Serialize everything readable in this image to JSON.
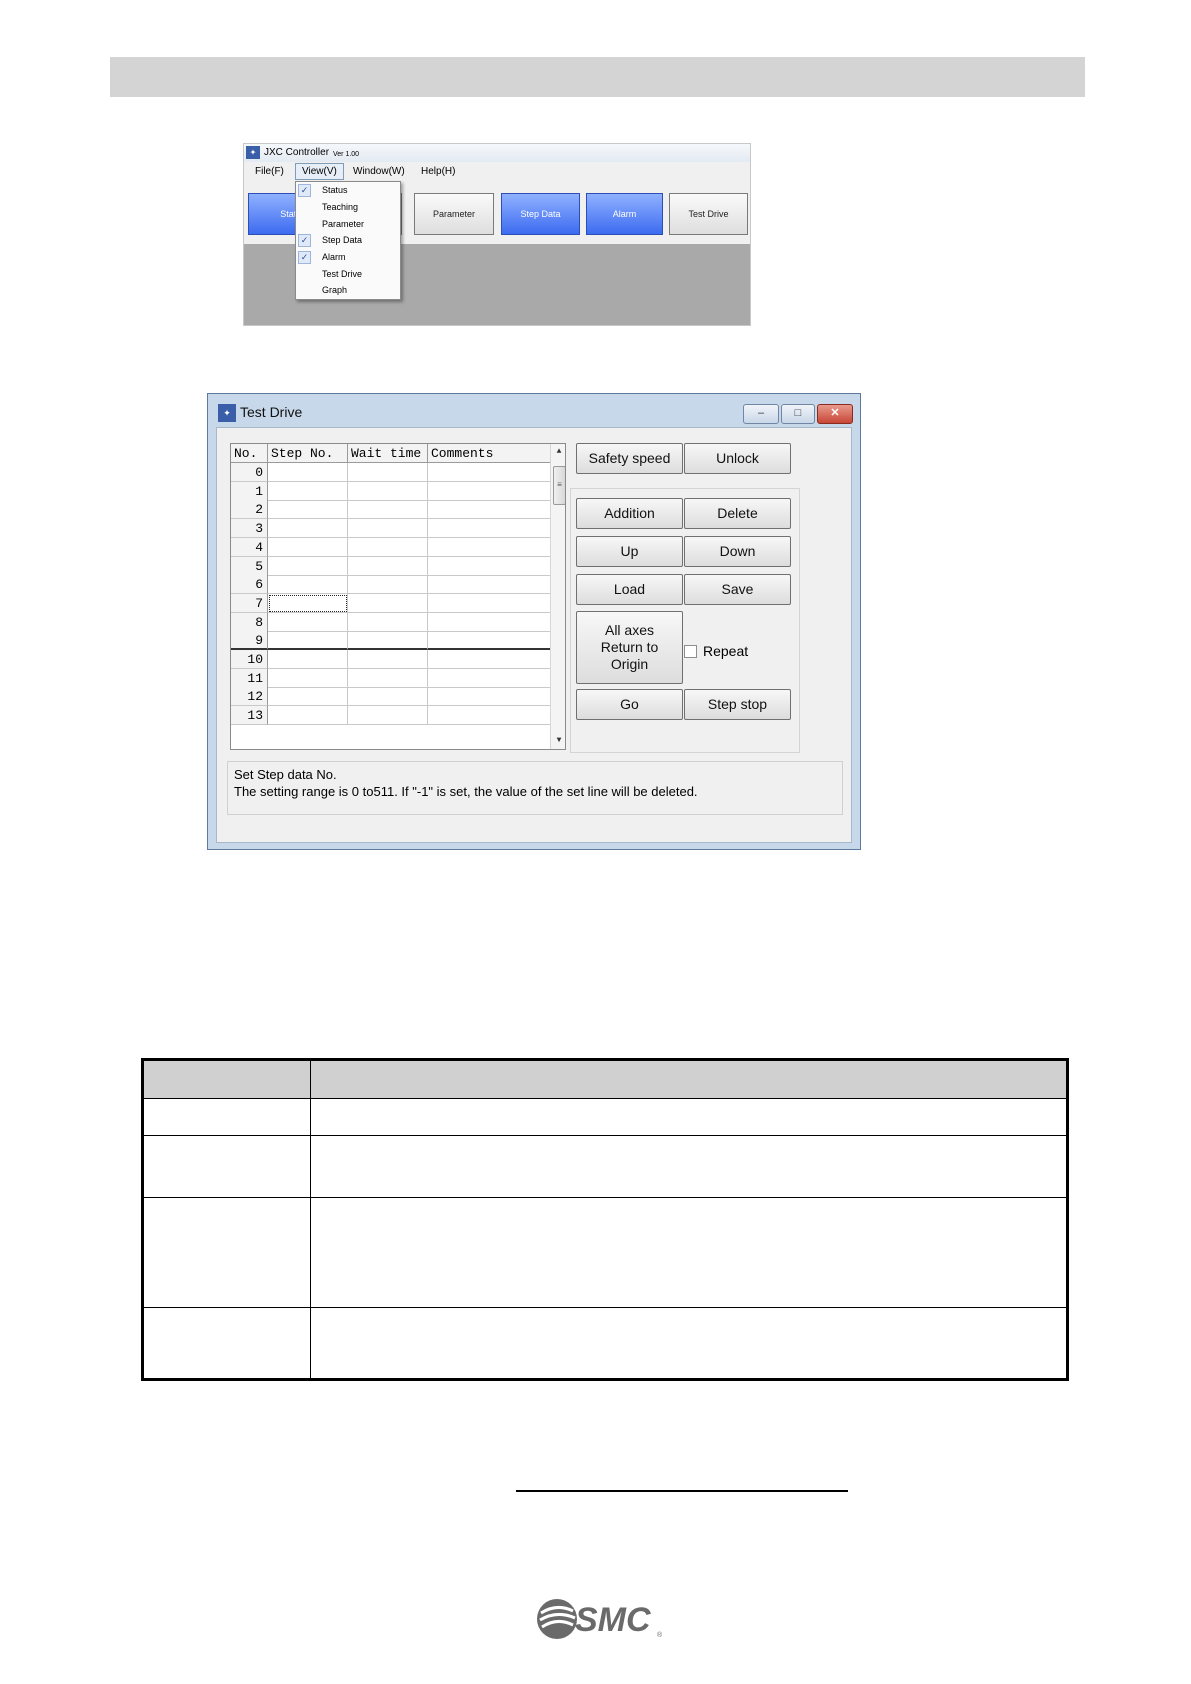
{
  "menu_screenshot": {
    "title": "JXC Controller",
    "version": "Ver 1.00",
    "menus": [
      "File(F)",
      "View(V)",
      "Window(W)",
      "Help(H)"
    ],
    "toolbar_buttons": [
      {
        "label": "Status",
        "style": "blue"
      },
      {
        "label": "",
        "style": "gray"
      },
      {
        "label": "Parameter",
        "style": "gray"
      },
      {
        "label": "Step Data",
        "style": "blue"
      },
      {
        "label": "Alarm",
        "style": "blue"
      },
      {
        "label": "Test Drive",
        "style": "gray"
      }
    ],
    "view_menu_items": [
      {
        "label": "Status",
        "checked": true
      },
      {
        "label": "Teaching",
        "checked": false
      },
      {
        "label": "Parameter",
        "checked": false
      },
      {
        "label": "Step Data",
        "checked": true
      },
      {
        "label": "Alarm",
        "checked": true
      },
      {
        "label": "Test Drive",
        "checked": false
      },
      {
        "label": "Graph",
        "checked": false
      }
    ]
  },
  "test_drive": {
    "title": "Test Drive",
    "window_controls": {
      "minimize": "–",
      "maximize": "□",
      "close": "✕"
    },
    "columns": [
      "No.",
      "Step No.",
      "Wait time",
      "Comments"
    ],
    "rows": [
      "0",
      "1",
      "2",
      "3",
      "4",
      "5",
      "6",
      "7",
      "8",
      "9",
      "10",
      "11",
      "12",
      "13"
    ],
    "buttons": {
      "safety_speed": "Safety speed",
      "unlock": "Unlock",
      "addition": "Addition",
      "delete": "Delete",
      "up": "Up",
      "down": "Down",
      "load": "Load",
      "save": "Save",
      "all_axes_1": "All axes",
      "all_axes_2": "Return to",
      "all_axes_3": "Origin",
      "go": "Go",
      "step_stop": "Step stop"
    },
    "repeat_label": "Repeat",
    "message_line1": "Set Step data No.",
    "message_line2": "The setting range is 0 to511.  If \"-1\" is set, the value of the set line will be deleted."
  },
  "icons": {
    "app": "jxc-app-icon",
    "check": "✓",
    "scroll_up": "▲",
    "scroll_down": "▼",
    "thumb_grip": "≡"
  },
  "colors": {
    "header_bar": "#d4d4d4",
    "blue_button": "#3d6bf0",
    "window_frame": "#c7d8ea",
    "logo": "#6a6a6a"
  },
  "logo": {
    "text": "SMC",
    "mark": "®"
  }
}
